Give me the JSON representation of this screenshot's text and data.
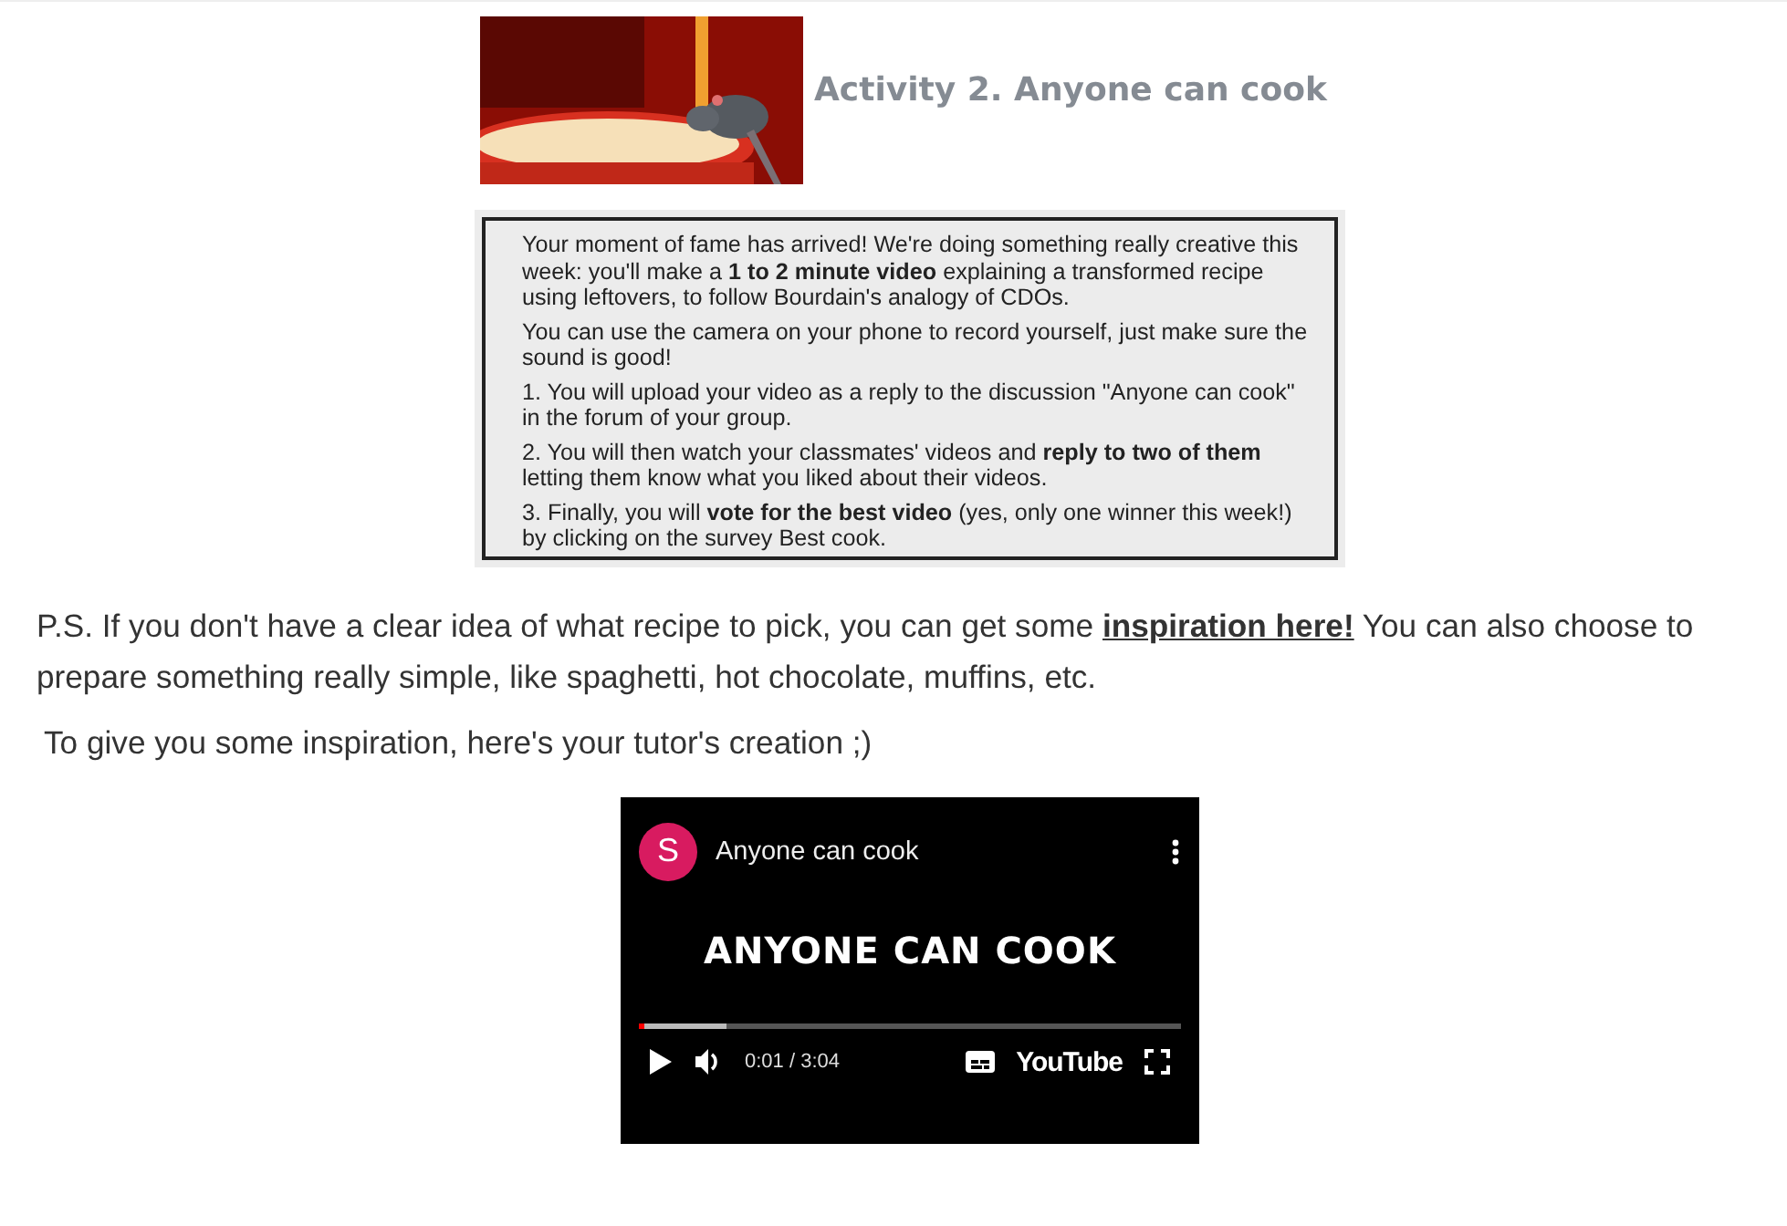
{
  "header": {
    "title": "Activity 2. Anyone can cook"
  },
  "instructions": [
    "Your moment of fame has arrived! We're doing something really creative this week: you'll make a **1 to 2 minute video** explaining a transformed recipe using leftovers, to follow Bourdain's analogy of CDOs.",
    "You can use the camera on your phone to record yourself, just make sure the sound is good!",
    "1. You will upload your video as a reply to the discussion \"Anyone can cook\" in the forum of your group.",
    "2. You will then watch your classmates' videos and **reply to two of them** letting them know what you liked about their videos.",
    "3. Finally, you will **vote for the best video** (yes, only one winner this week!) by clicking on the survey  Best cook."
  ],
  "ps": {
    "before": "P.S. If you don't have a clear idea of what recipe to pick, you can get some",
    "link": "inspiration here!",
    "after": "You can also choose to prepare something really simple, like spaghetti, hot chocolate, muffins, etc."
  },
  "intro": "To give you some inspiration, here's your tutor's creation ;)",
  "video": {
    "avatar": "S",
    "title": "Anyone can cook",
    "screen_text": "ANYONE CAN COOK",
    "progress": {
      "level": 0.01
    },
    "time": "0:01 / 3:04",
    "logo": "YouTube"
  }
}
